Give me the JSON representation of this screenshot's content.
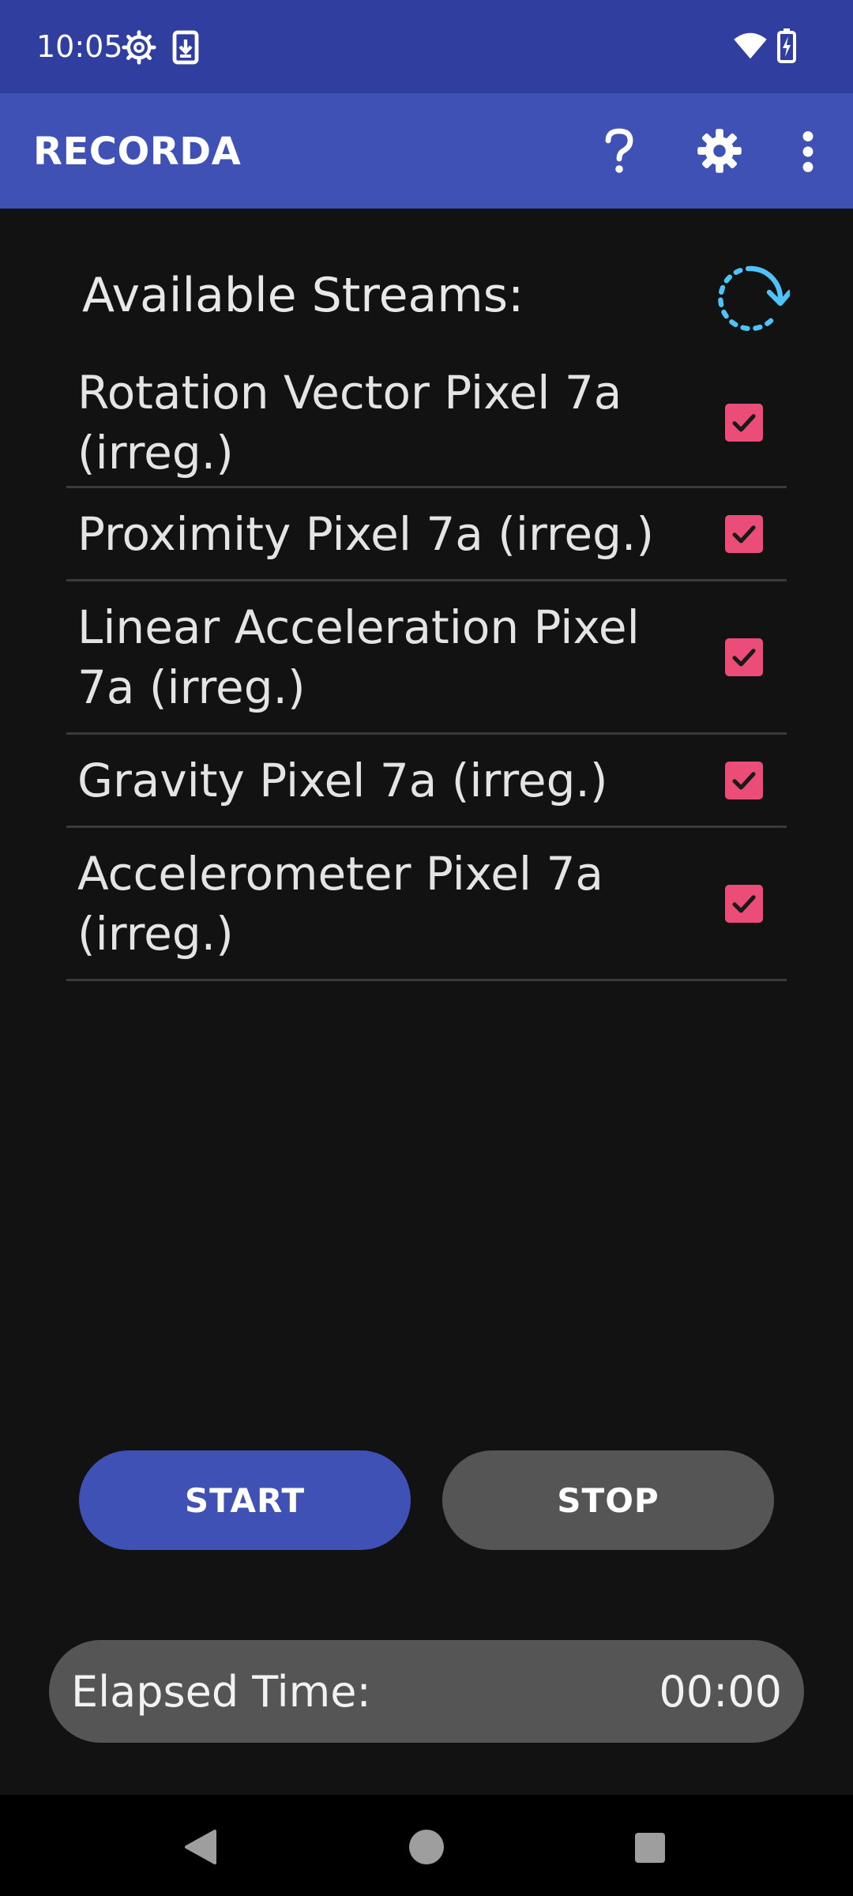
{
  "status_bar": {
    "time": "10:05",
    "icons": [
      "settings-gear-icon",
      "download-icon",
      "wifi-icon",
      "battery-charging-icon"
    ]
  },
  "app_bar": {
    "title": "RECORDA",
    "icons": [
      "help-icon",
      "settings-icon",
      "more-vert-icon"
    ]
  },
  "streams": {
    "title": "Available Streams:",
    "refresh_icon": "refresh-icon",
    "items": [
      {
        "label": "Rotation Vector Pixel 7a (irreg.)",
        "checked": true
      },
      {
        "label": "Proximity Pixel 7a (irreg.)",
        "checked": true
      },
      {
        "label": "Linear Acceleration Pixel 7a (irreg.)",
        "checked": true
      },
      {
        "label": "Gravity Pixel 7a (irreg.)",
        "checked": true
      },
      {
        "label": "Accelerometer Pixel 7a (irreg.)",
        "checked": true
      }
    ]
  },
  "controls": {
    "start_label": "START",
    "stop_label": "STOP"
  },
  "elapsed": {
    "label": "Elapsed Time:",
    "value": "00:00"
  },
  "colors": {
    "status_bar": "#303F9F",
    "app_bar": "#3F51B5",
    "background": "#121212",
    "checkbox": "#EC4C78",
    "start_button": "#3F51B5",
    "stop_button": "#555555",
    "refresh_icon": "#4FC3F7"
  },
  "nav_bar": {
    "icons": [
      "back-icon",
      "home-icon",
      "recents-icon"
    ]
  }
}
